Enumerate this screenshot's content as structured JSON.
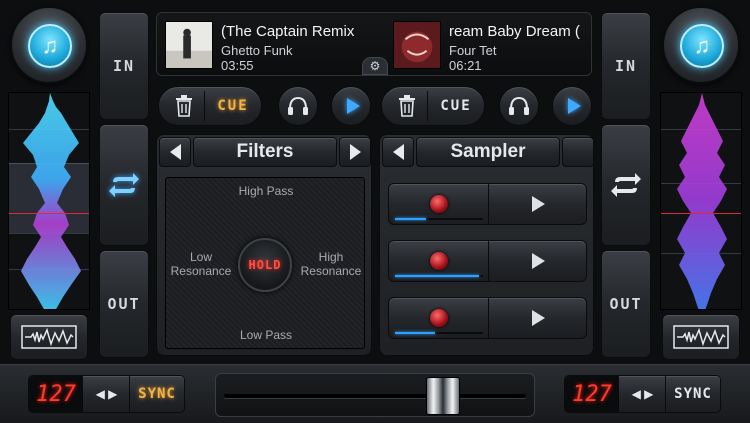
{
  "colors": {
    "accent_blue": "#3fa9ff",
    "cue_orange": "#f0b54a",
    "led_red": "#ff3b30",
    "wave_left": "#3fd2ff",
    "wave_right": "#d23fd6"
  },
  "left_deck": {
    "add_icon": "add-music-icon",
    "in_label": "IN",
    "out_label": "OUT",
    "loop_icon": "loop-icon",
    "overview_icon": "waveform-overview-icon",
    "track": {
      "title": "(The Captain Remix",
      "artist": "Ghetto Funk",
      "time": "03:55"
    },
    "cue_label": "CUE",
    "bpm": "127",
    "nudge_label": "◀ ▶",
    "sync_label": "SYNC"
  },
  "right_deck": {
    "add_icon": "add-music-icon",
    "in_label": "IN",
    "out_label": "OUT",
    "loop_icon": "loop-icon",
    "overview_icon": "waveform-overview-icon",
    "track": {
      "title": "ream Baby Dream (",
      "artist": "Four Tet",
      "time": "06:21"
    },
    "cue_label": "CUE",
    "bpm": "127",
    "nudge_label": "◀ ▶",
    "sync_label": "SYNC"
  },
  "filters": {
    "title": "Filters",
    "high_pass": "High Pass",
    "low_pass": "Low Pass",
    "low_res": "Low\nResonance",
    "high_res": "High\nResonance",
    "hold_label": "HOLD"
  },
  "sampler": {
    "title": "Sampler",
    "rows": [
      {
        "progress": 0.35
      },
      {
        "progress": 0.95
      },
      {
        "progress": 0.45
      }
    ]
  },
  "crossfader": {
    "position": 0.74
  }
}
